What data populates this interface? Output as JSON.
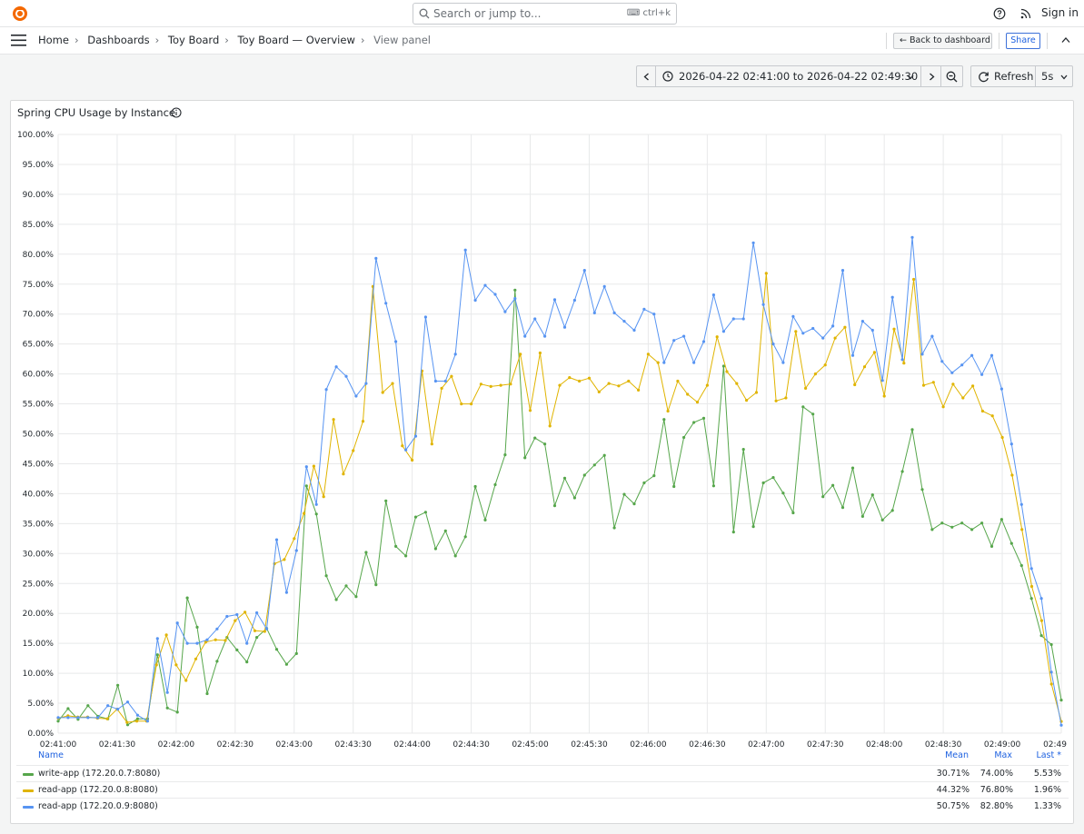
{
  "search": {
    "placeholder": "Search or jump to...",
    "shortcut": "ctrl+k"
  },
  "header": {
    "signin_label": "Sign in"
  },
  "breadcrumb": [
    "Home",
    "Dashboards",
    "Toy Board",
    "Toy Board — Overview",
    "View panel"
  ],
  "toolbar": {
    "back_label": "Back to dashboard",
    "share_label": "Share"
  },
  "timepicker": {
    "range_label": "2026-04-22 02:41:00 to 2026-04-22 02:49:30",
    "refresh_label": "Refresh",
    "interval": "5s"
  },
  "panel": {
    "title": "Spring CPU Usage by Instance"
  },
  "legend": {
    "headers": {
      "name": "Name",
      "mean": "Mean",
      "max": "Max",
      "last": "Last *"
    },
    "rows": [
      {
        "name": "write-app (172.20.0.7:8080)",
        "color": "#56a64b",
        "mean": "30.71%",
        "max": "74.00%",
        "last": "5.53%"
      },
      {
        "name": "read-app (172.20.0.8:8080)",
        "color": "#e0b400",
        "mean": "44.32%",
        "max": "76.80%",
        "last": "1.96%"
      },
      {
        "name": "read-app (172.20.0.9:8080)",
        "color": "#5794f2",
        "mean": "50.75%",
        "max": "82.80%",
        "last": "1.33%"
      }
    ]
  },
  "chart_data": {
    "type": "line",
    "title": "Spring CPU Usage by Instance",
    "xlabel": "",
    "ylabel": "",
    "ylim": [
      0,
      100
    ],
    "y_unit": "%",
    "y_ticks": [
      "0.00%",
      "5.00%",
      "10.00%",
      "15.00%",
      "20.00%",
      "25.00%",
      "30.00%",
      "35.00%",
      "40.00%",
      "45.00%",
      "50.00%",
      "55.00%",
      "60.00%",
      "65.00%",
      "70.00%",
      "75.00%",
      "80.00%",
      "85.00%",
      "90.00%",
      "95.00%",
      "100.00%"
    ],
    "x_ticks": [
      "02:41:00",
      "02:41:30",
      "02:42:00",
      "02:42:30",
      "02:43:00",
      "02:43:30",
      "02:44:00",
      "02:44:30",
      "02:45:00",
      "02:45:30",
      "02:46:00",
      "02:46:30",
      "02:47:00",
      "02:47:30",
      "02:48:00",
      "02:48:30",
      "02:49:00",
      "02:49"
    ],
    "x_range": [
      "02:41:00",
      "02:49:30"
    ],
    "sample_interval": "5s",
    "grid": true,
    "legend_position": "bottom",
    "series": [
      {
        "name": "write-app (172.20.0.7:8080)",
        "color": "#56a64b",
        "values": [
          2.0,
          4.1,
          2.3,
          4.6,
          2.8,
          2.4,
          8.0,
          1.4,
          2.4,
          2.4,
          13.1,
          4.2,
          3.5,
          22.6,
          17.7,
          6.6,
          12.0,
          16.0,
          13.9,
          11.9,
          16.0,
          17.5,
          14.0,
          11.5,
          13.3,
          41.3,
          36.6,
          26.3,
          22.3,
          24.6,
          22.8,
          30.2,
          24.8,
          38.8,
          31.2,
          29.6,
          36.1,
          36.9,
          30.8,
          33.8,
          29.6,
          32.8,
          41.2,
          35.6,
          41.5,
          46.5,
          74.0,
          46.0,
          49.3,
          48.3,
          38.0,
          42.6,
          39.3,
          43.1,
          44.8,
          46.4,
          34.3,
          39.9,
          38.3,
          41.8,
          43.0,
          52.4,
          41.2,
          49.4,
          51.9,
          52.6,
          41.3,
          61.3,
          33.6,
          47.4,
          34.5,
          41.8,
          42.7,
          40.1,
          36.8,
          54.5,
          53.3,
          39.5,
          41.4,
          37.7,
          44.3,
          36.2,
          39.8,
          35.6,
          37.2,
          43.7,
          50.7,
          40.7,
          34.0,
          35.1,
          34.4,
          35.1,
          34.0,
          35.1,
          31.2,
          35.7,
          31.7,
          28.0,
          22.5,
          16.3,
          14.8,
          5.53
        ]
      },
      {
        "name": "read-app (172.20.0.8:8080)",
        "color": "#e0b400",
        "values": [
          2.5,
          2.9,
          2.7,
          2.7,
          2.5,
          2.4,
          4.0,
          1.8,
          2.0,
          2.0,
          11.4,
          16.4,
          11.4,
          8.8,
          12.4,
          15.2,
          15.6,
          15.5,
          18.8,
          20.2,
          17.1,
          17.0,
          28.3,
          29.0,
          32.5,
          36.7,
          44.6,
          39.5,
          52.4,
          43.3,
          47.2,
          52.1,
          74.6,
          56.9,
          58.4,
          48.0,
          45.6,
          60.5,
          48.3,
          57.6,
          59.6,
          55.0,
          55.0,
          58.3,
          57.9,
          58.1,
          58.3,
          63.3,
          53.9,
          63.5,
          51.3,
          58.1,
          59.4,
          58.8,
          59.3,
          57.0,
          58.4,
          58.0,
          58.8,
          57.3,
          63.3,
          61.9,
          53.8,
          58.8,
          56.6,
          55.3,
          58.1,
          66.2,
          60.4,
          58.4,
          55.6,
          56.9,
          76.8,
          55.5,
          56.0,
          67.1,
          57.6,
          60.0,
          61.5,
          66.0,
          67.8,
          58.2,
          61.2,
          63.6,
          56.3,
          67.5,
          61.8,
          75.8,
          58.1,
          58.6,
          54.5,
          58.3,
          56.0,
          58.0,
          53.8,
          53.0,
          49.4,
          43.1,
          34.0,
          24.5,
          18.8,
          8.2,
          1.96
        ]
      },
      {
        "name": "read-app (172.20.0.9:8080)",
        "color": "#5794f2",
        "values": [
          2.6,
          2.6,
          2.6,
          2.6,
          2.6,
          4.6,
          4.0,
          5.2,
          3.0,
          2.0,
          15.8,
          6.8,
          18.4,
          15.0,
          15.0,
          15.6,
          17.4,
          19.5,
          19.8,
          15.0,
          20.1,
          17.4,
          32.3,
          23.5,
          30.5,
          44.5,
          38.2,
          57.4,
          61.2,
          59.6,
          56.3,
          58.4,
          79.3,
          71.8,
          65.4,
          47.3,
          49.6,
          69.5,
          58.8,
          58.8,
          63.3,
          80.7,
          72.3,
          74.8,
          73.3,
          70.4,
          72.6,
          66.3,
          69.2,
          66.3,
          72.4,
          67.8,
          72.3,
          77.3,
          70.2,
          74.6,
          70.2,
          68.8,
          67.3,
          70.8,
          70.0,
          61.9,
          65.6,
          66.3,
          61.9,
          65.4,
          73.2,
          67.1,
          69.2,
          69.2,
          81.9,
          71.6,
          65.0,
          61.9,
          69.6,
          66.8,
          67.6,
          66.0,
          68.0,
          77.3,
          63.1,
          68.8,
          67.3,
          58.9,
          72.8,
          62.4,
          82.8,
          63.3,
          66.3,
          62.1,
          60.2,
          61.5,
          63.1,
          59.9,
          63.1,
          57.5,
          48.3,
          38.2,
          27.5,
          22.5,
          10.2,
          1.33
        ]
      }
    ]
  }
}
